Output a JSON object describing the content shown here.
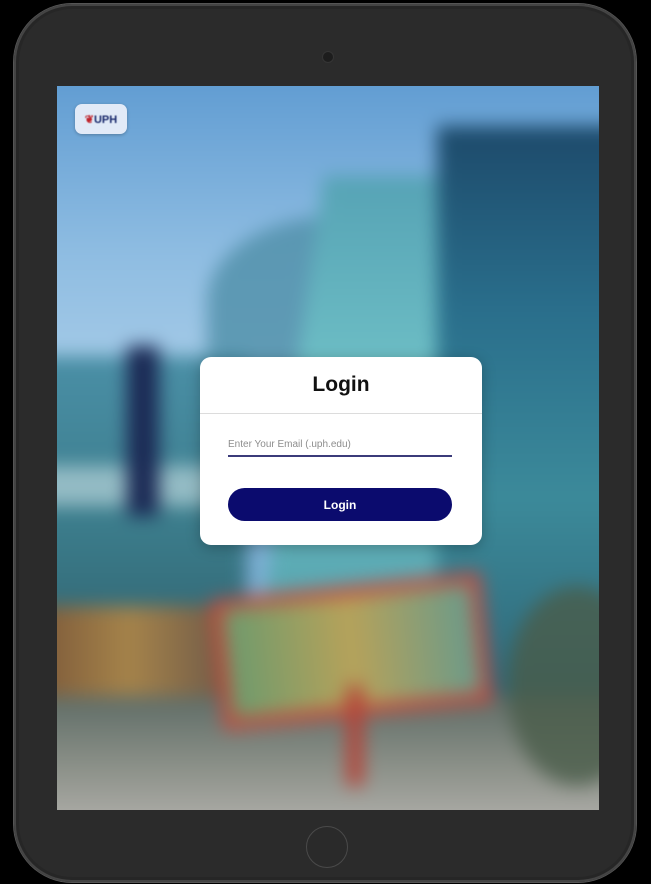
{
  "logo": {
    "mark": "❦",
    "text": "UPH"
  },
  "login_card": {
    "title": "Login",
    "email_placeholder": "Enter Your Email (.uph.edu)",
    "email_value": "",
    "login_button_label": "Login"
  },
  "colors": {
    "button_background": "#0b0b6e",
    "input_underline": "#3b3b7a",
    "card_background": "#ffffff",
    "device_frame": "#2b2b2b"
  },
  "icons": {
    "home_button": "home-button-icon",
    "camera": "camera-icon"
  }
}
